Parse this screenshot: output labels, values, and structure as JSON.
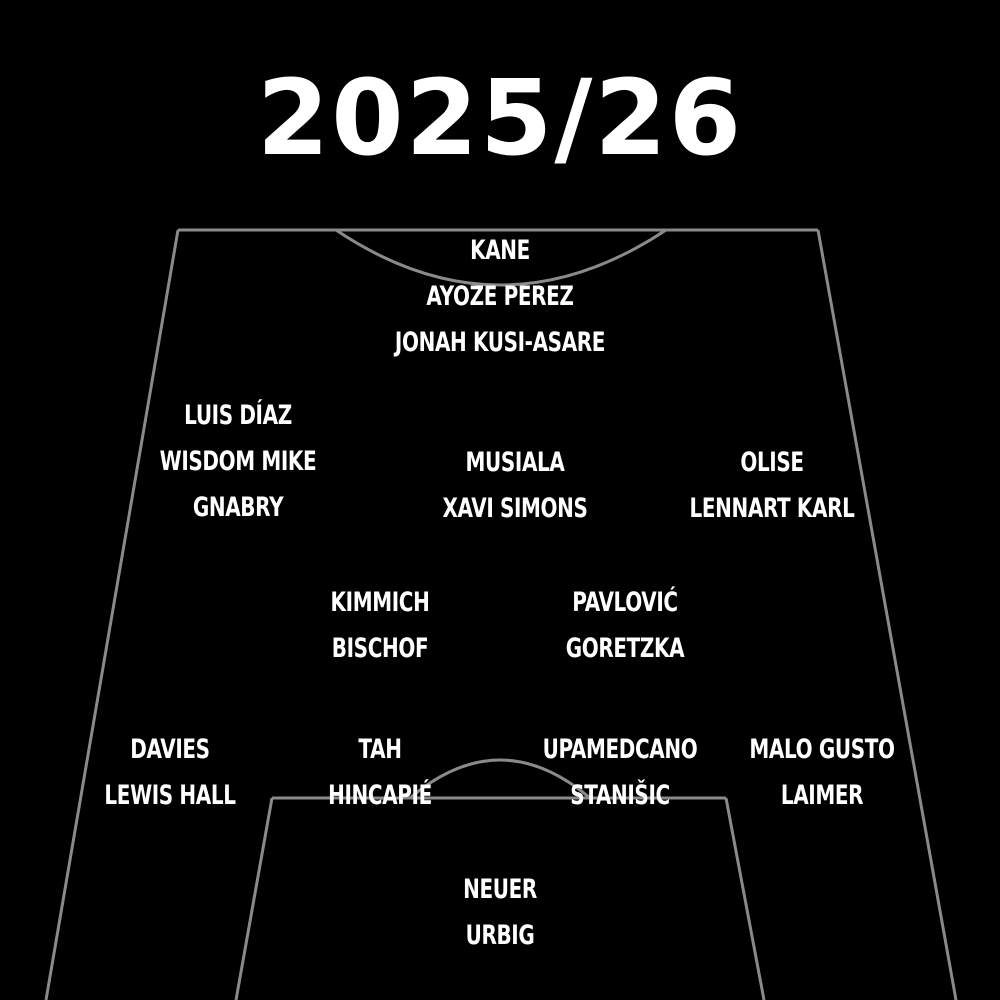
{
  "season": "2025/26",
  "colors": {
    "background": "#000000",
    "text": "#ffffff",
    "pitch_lines": "#8a8a8a"
  },
  "positions": {
    "striker": [
      "KANE",
      "AYOZE PEREZ",
      "JONAH KUSI-ASARE"
    ],
    "left_wing": [
      "LUIS DÍAZ",
      "WISDOM MIKE",
      "GNABRY"
    ],
    "attacking_mid": [
      "MUSIALA",
      "XAVI SIMONS"
    ],
    "right_wing": [
      "OLISE",
      "LENNART KARL"
    ],
    "left_cm": [
      "KIMMICH",
      "BISCHOF"
    ],
    "right_cm": [
      "PAVLOVIĆ",
      "GORETZKA"
    ],
    "left_back": [
      "DAVIES",
      "LEWIS HALL"
    ],
    "left_cb": [
      "TAH",
      "HINCAPIÉ"
    ],
    "right_cb": [
      "UPAMEDCANO",
      "STANIŠIC"
    ],
    "right_back": [
      "MALO GUSTO",
      "LAIMER"
    ],
    "goalkeeper": [
      "NEUER",
      "URBIG"
    ]
  }
}
